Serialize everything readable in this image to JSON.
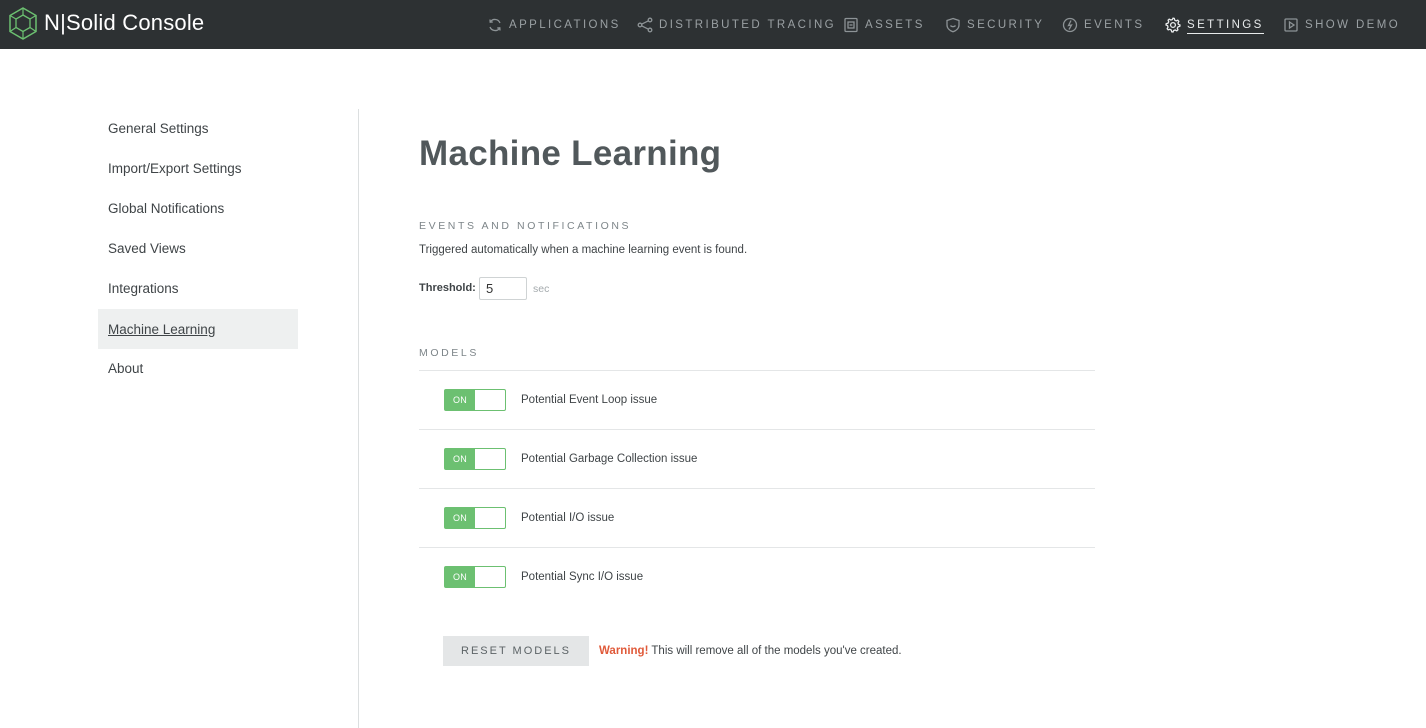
{
  "header": {
    "brand": "N|Solid Console",
    "nav": [
      {
        "label": "APPLICATIONS",
        "icon": "refresh-icon"
      },
      {
        "label": "DISTRIBUTED TRACING",
        "icon": "share-nodes-icon"
      },
      {
        "label": "ASSETS",
        "icon": "assets-icon"
      },
      {
        "label": "SECURITY",
        "icon": "shield-icon"
      },
      {
        "label": "EVENTS",
        "icon": "bolt-icon"
      },
      {
        "label": "SETTINGS",
        "icon": "gear-icon",
        "active": true
      },
      {
        "label": "SHOW DEMO",
        "icon": "play-icon"
      }
    ]
  },
  "sidebar": {
    "items": [
      {
        "label": "General Settings"
      },
      {
        "label": "Import/Export Settings"
      },
      {
        "label": "Global Notifications"
      },
      {
        "label": "Saved Views"
      },
      {
        "label": "Integrations"
      },
      {
        "label": "Machine Learning",
        "active": true
      },
      {
        "label": "About"
      }
    ]
  },
  "main": {
    "title": "Machine Learning",
    "events": {
      "heading": "EVENTS AND NOTIFICATIONS",
      "description": "Triggered automatically when a machine learning event is found.",
      "threshold_label": "Threshold:",
      "threshold_value": "5",
      "threshold_unit": "sec"
    },
    "models": {
      "heading": "MODELS",
      "items": [
        {
          "label": "Potential Event Loop issue",
          "toggle": "ON"
        },
        {
          "label": "Potential Garbage Collection issue",
          "toggle": "ON"
        },
        {
          "label": "Potential I/O issue",
          "toggle": "ON"
        },
        {
          "label": "Potential Sync I/O issue",
          "toggle": "ON"
        }
      ]
    },
    "reset": {
      "button": "RESET MODELS",
      "warning_label": "Warning!",
      "warning_text": " This will remove all of the models you've created."
    }
  },
  "colors": {
    "topbar": "#2d3133",
    "toggle_on": "#6cc071",
    "warning": "#e05a3a"
  }
}
